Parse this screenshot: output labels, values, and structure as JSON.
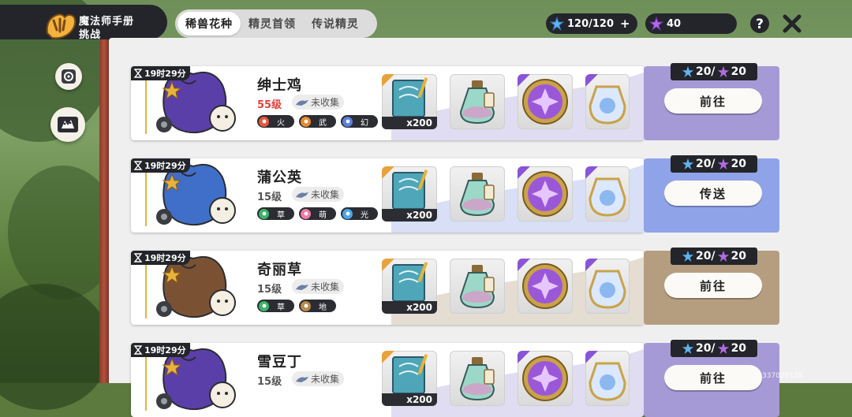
{
  "header": {
    "title": "魔法师手册",
    "subtitle": "挑战"
  },
  "tabs": [
    {
      "label": "稀兽花种",
      "active": true
    },
    {
      "label": "精灵首领",
      "active": false
    },
    {
      "label": "传说精灵",
      "active": false
    }
  ],
  "currency": {
    "stamina": "120/120",
    "stamina_add": "+",
    "gems": "40"
  },
  "challenges": [
    {
      "timer": "19时29分",
      "name": "绅士鸡",
      "level": "55级",
      "level_red": true,
      "status": "未收集",
      "types": [
        {
          "label": "火",
          "color": "#e8573f"
        },
        {
          "label": "武",
          "color": "#e88a2e"
        },
        {
          "label": "幻",
          "color": "#5a7fe0"
        }
      ],
      "book_count": "x200",
      "cost": "20/",
      "cost2": "20",
      "button": "前往",
      "theme": "purple"
    },
    {
      "timer": "19时29分",
      "name": "蒲公英",
      "level": "15级",
      "level_red": false,
      "status": "未收集",
      "types": [
        {
          "label": "草",
          "color": "#3db36a"
        },
        {
          "label": "萌",
          "color": "#f07aa5"
        },
        {
          "label": "光",
          "color": "#4aa6e8"
        }
      ],
      "book_count": "x200",
      "cost": "20/",
      "cost2": "20",
      "button": "传送",
      "theme": "blue"
    },
    {
      "timer": "19时29分",
      "name": "奇丽草",
      "level": "15级",
      "level_red": false,
      "status": "未收集",
      "types": [
        {
          "label": "草",
          "color": "#3db36a"
        },
        {
          "label": "地",
          "color": "#b88a48"
        }
      ],
      "book_count": "x200",
      "cost": "20/",
      "cost2": "20",
      "button": "前往",
      "theme": "brown"
    },
    {
      "timer": "19时29分",
      "name": "雪豆丁",
      "level": "15级",
      "level_red": false,
      "status": "未收集",
      "types": [],
      "book_count": "x200",
      "cost": "20/",
      "cost2": "20",
      "button": "前往",
      "theme": "purple"
    }
  ],
  "uid": "337029128",
  "colors": {
    "purple": "#a69ad6",
    "blue": "#8fa3e8",
    "brown": "#b59e7f"
  }
}
